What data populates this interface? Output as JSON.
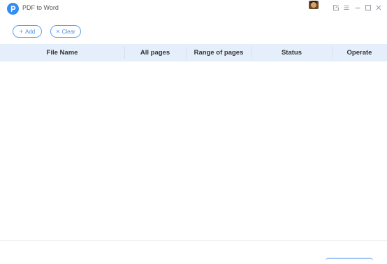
{
  "app": {
    "title": "PDF to Word",
    "logo_letter": "P",
    "accent_color": "#2f8df5"
  },
  "window_controls": {
    "icons": [
      "edit-icon",
      "menu-icon",
      "minimize-icon",
      "maximize-icon",
      "close-icon"
    ]
  },
  "toolbar": {
    "add_label": "Add",
    "add_icon": "+",
    "clear_label": "Clear",
    "clear_icon": "×"
  },
  "table": {
    "columns": [
      "File Name",
      "All pages",
      "Range of pages",
      "Status",
      "Operate"
    ],
    "header_color": "#e5effb",
    "rows": []
  }
}
